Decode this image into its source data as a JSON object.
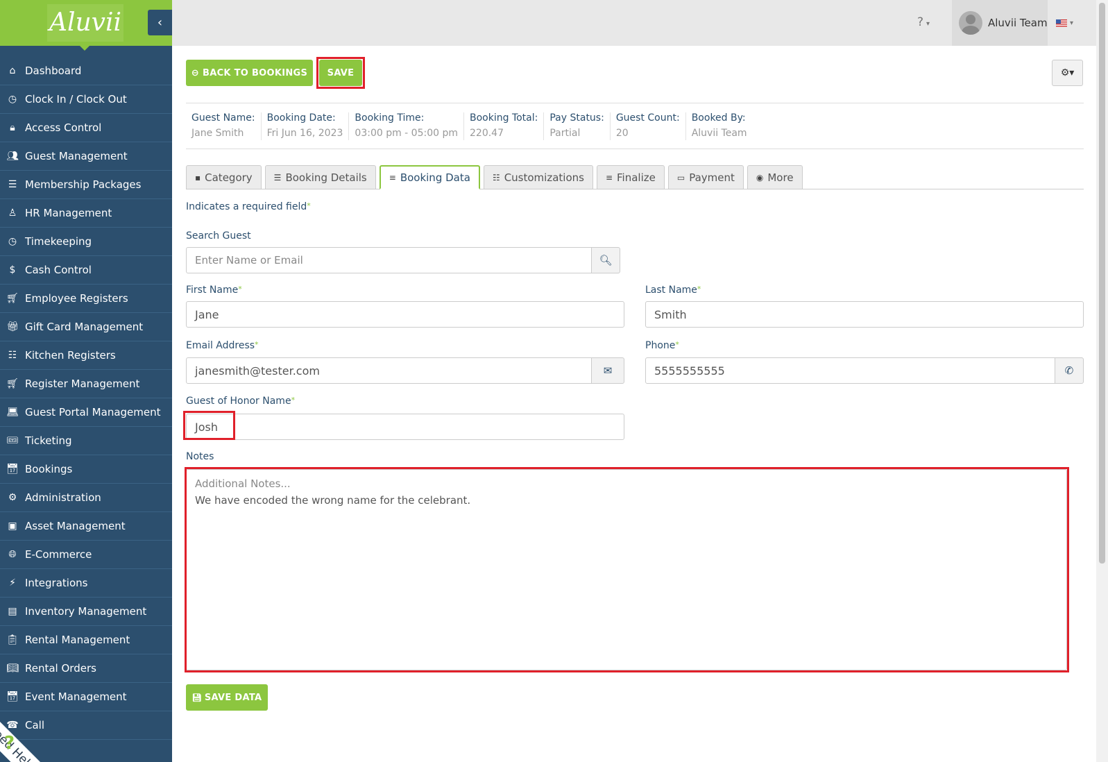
{
  "sidebar": {
    "logo": "Aluvii",
    "collapse_icon": "chevron-left-icon",
    "items": [
      {
        "icon": "home-icon",
        "glyph": "⌂",
        "label": "Dashboard"
      },
      {
        "icon": "clock-icon",
        "glyph": "◷",
        "label": "Clock In / Clock Out"
      },
      {
        "icon": "lock-icon",
        "glyph": "🔒︎",
        "label": "Access Control"
      },
      {
        "icon": "users-icon",
        "glyph": "👥︎",
        "label": "Guest Management"
      },
      {
        "icon": "list-icon",
        "glyph": "☰",
        "label": "Membership Packages"
      },
      {
        "icon": "user-icon",
        "glyph": "♙",
        "label": "HR Management"
      },
      {
        "icon": "clock-icon",
        "glyph": "◷",
        "label": "Timekeeping"
      },
      {
        "icon": "dollar-icon",
        "glyph": "$",
        "label": "Cash Control"
      },
      {
        "icon": "cart-icon",
        "glyph": "🛒︎",
        "label": "Employee Registers"
      },
      {
        "icon": "gift-icon",
        "glyph": "🎁︎",
        "label": "Gift Card Management"
      },
      {
        "icon": "list-icon",
        "glyph": "☷",
        "label": "Kitchen Registers"
      },
      {
        "icon": "cart-icon",
        "glyph": "🛒︎",
        "label": "Register Management"
      },
      {
        "icon": "laptop-icon",
        "glyph": "💻︎",
        "label": "Guest Portal Management"
      },
      {
        "icon": "ticket-icon",
        "glyph": "🎟︎",
        "label": "Ticketing"
      },
      {
        "icon": "calendar-icon",
        "glyph": "📅︎",
        "label": "Bookings"
      },
      {
        "icon": "cogs-icon",
        "glyph": "⚙",
        "label": "Administration"
      },
      {
        "icon": "cubes-icon",
        "glyph": "▣",
        "label": "Asset Management"
      },
      {
        "icon": "globe-icon",
        "glyph": "🌐︎",
        "label": "E-Commerce"
      },
      {
        "icon": "bolt-icon",
        "glyph": "⚡︎",
        "label": "Integrations"
      },
      {
        "icon": "archive-icon",
        "glyph": "▤",
        "label": "Inventory Management"
      },
      {
        "icon": "clipboard-icon",
        "glyph": "📋︎",
        "label": "Rental Management"
      },
      {
        "icon": "book-icon",
        "glyph": "📖︎",
        "label": "Rental Orders"
      },
      {
        "icon": "calendar-icon",
        "glyph": "📅︎",
        "label": "Event Management"
      },
      {
        "icon": "phone-icon",
        "glyph": "☎",
        "label": "Call"
      }
    ],
    "help_label": "Need Help",
    "help_glyph": "?"
  },
  "topbar": {
    "help_icon": "question-circle-icon",
    "help_glyph": "?",
    "user_name": "Aluvii Team",
    "language_icon": "us-flag-icon"
  },
  "toolbar": {
    "back_label": "BACK TO BOOKINGS",
    "back_icon_glyph": "⊖",
    "save_label": "SAVE",
    "gear_glyph": "⚙▾"
  },
  "summary": [
    {
      "label": "Guest Name:",
      "value": "Jane Smith"
    },
    {
      "label": "Booking Date:",
      "value": "Fri Jun 16, 2023"
    },
    {
      "label": "Booking Time:",
      "value": "03:00 pm - 05:00 pm"
    },
    {
      "label": "Booking Total:",
      "value": "220.47"
    },
    {
      "label": "Pay Status:",
      "value": "Partial"
    },
    {
      "label": "Guest Count:",
      "value": "20"
    },
    {
      "label": "Booked By:",
      "value": "Aluvii Team"
    }
  ],
  "tabs": [
    {
      "label": "Category",
      "glyph": "▪",
      "icon": "book-icon"
    },
    {
      "label": "Booking Details",
      "glyph": "☰",
      "icon": "list-icon"
    },
    {
      "label": "Booking Data",
      "glyph": "≡",
      "icon": "database-icon",
      "active": true
    },
    {
      "label": "Customizations",
      "glyph": "☷",
      "icon": "sliders-icon"
    },
    {
      "label": "Finalize",
      "glyph": "≡",
      "icon": "database-icon"
    },
    {
      "label": "Payment",
      "glyph": "▭",
      "icon": "credit-card-icon"
    },
    {
      "label": "More",
      "glyph": "◉",
      "icon": "chevron-circle-icon"
    }
  ],
  "form": {
    "required_note": "Indicates a required field",
    "required_mark": "*",
    "search_label": "Search Guest",
    "search_placeholder": "Enter Name or Email",
    "search_glyph": "🔍︎",
    "first_name_label": "First Name",
    "first_name_value": "Jane",
    "last_name_label": "Last Name",
    "last_name_value": "Smith",
    "email_label": "Email Address",
    "email_value": "janesmith@tester.com",
    "email_glyph": "✉",
    "phone_label": "Phone",
    "phone_value": "5555555555",
    "phone_glyph": "✆",
    "honor_label": "Guest of Honor Name",
    "honor_value": "Josh",
    "notes_label": "Notes",
    "notes_placeholder": "Additional Notes...",
    "notes_value": "We have encoded the wrong name for the celebrant.",
    "save_data_label": "SAVE DATA",
    "save_data_glyph": "💾︎"
  },
  "colors": {
    "accent": "#8cc63f",
    "sidebar": "#2c4f6e",
    "highlight": "#e0202a"
  }
}
